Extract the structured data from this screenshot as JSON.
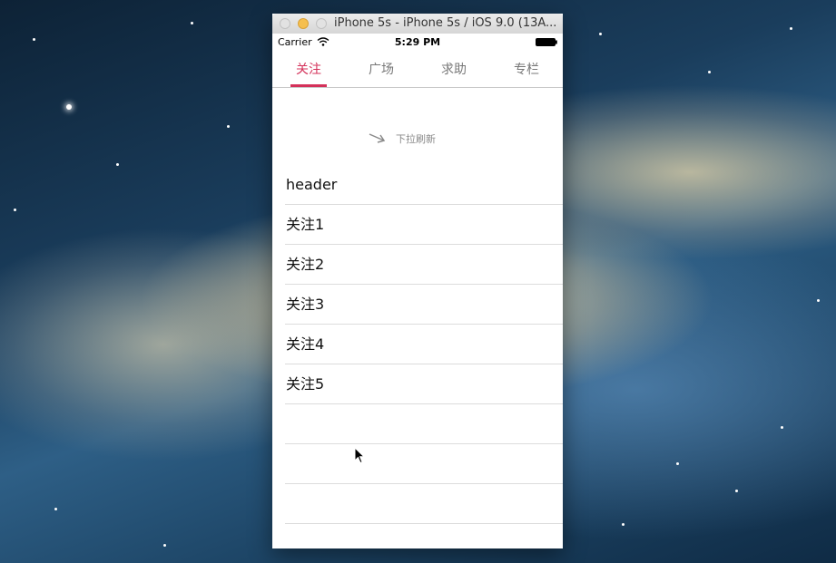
{
  "window": {
    "title": "iPhone 5s - iPhone 5s / iOS 9.0 (13A..."
  },
  "status_bar": {
    "carrier": "Carrier",
    "time": "5:29 PM"
  },
  "tabs": [
    {
      "label": "关注",
      "active": true
    },
    {
      "label": "广场",
      "active": false
    },
    {
      "label": "求助",
      "active": false
    },
    {
      "label": "专栏",
      "active": false
    }
  ],
  "refresh": {
    "text": "下拉刷新"
  },
  "table": {
    "rows": [
      "header",
      "关注1",
      "关注2",
      "关注3",
      "关注4",
      "关注5",
      "",
      "",
      ""
    ]
  },
  "colors": {
    "accent": "#d4315a",
    "tab_inactive": "#777777",
    "separator": "#dcdcdc"
  },
  "icons": {
    "wifi": "wifi-icon",
    "battery": "battery-icon",
    "pull_arrow": "arrow-down-right-icon",
    "cursor": "mouse-pointer-icon"
  }
}
